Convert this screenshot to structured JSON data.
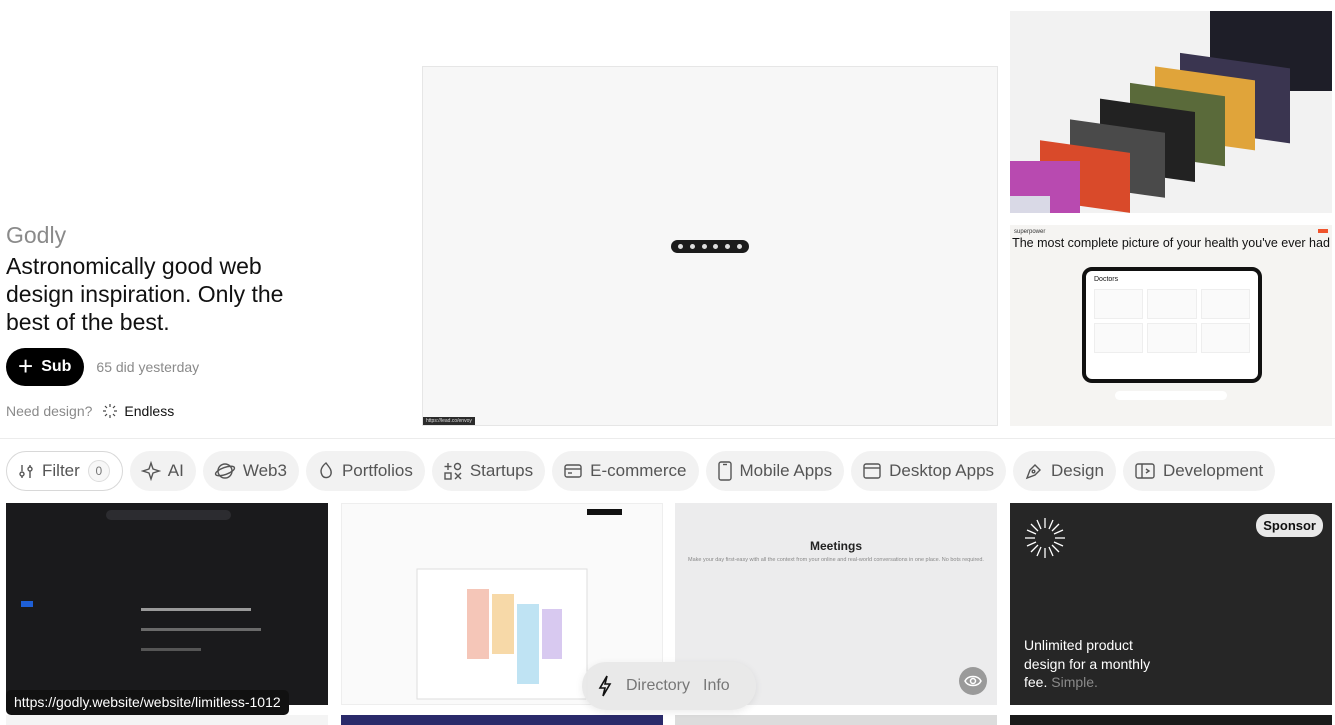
{
  "hero": {
    "brand": "Godly",
    "tagline": "Astronomically good web design inspiration. Only the best of the best.",
    "sub_button": "Sub",
    "sub_count": "65 did yesterday",
    "need_label": "Need design?",
    "endless_label": "Endless"
  },
  "featured": {
    "url_chip": "https://lead.co/envoy"
  },
  "superpower_card": {
    "brand": "superpower",
    "title": "The most complete picture of your health you've ever had",
    "section": "Doctors"
  },
  "filters": {
    "filter_label": "Filter",
    "filter_count": "0",
    "categories": [
      "AI",
      "Web3",
      "Portfolios",
      "Startups",
      "E-commerce",
      "Mobile Apps",
      "Desktop Apps",
      "Design",
      "Development"
    ]
  },
  "tiles": {
    "meetings_title": "Meetings",
    "meetings_sub": "Make your day first-easy with all the context from your online and real-world conversations in one place. No bots required.",
    "sponsor_badge": "Sponsor",
    "sponsor_text": "Unlimited product design for a monthly fee.",
    "sponsor_muted": "Simple."
  },
  "url_tooltip": "https://godly.website/website/limitless-1012",
  "floating_nav": {
    "directory": "Directory",
    "info": "Info"
  }
}
